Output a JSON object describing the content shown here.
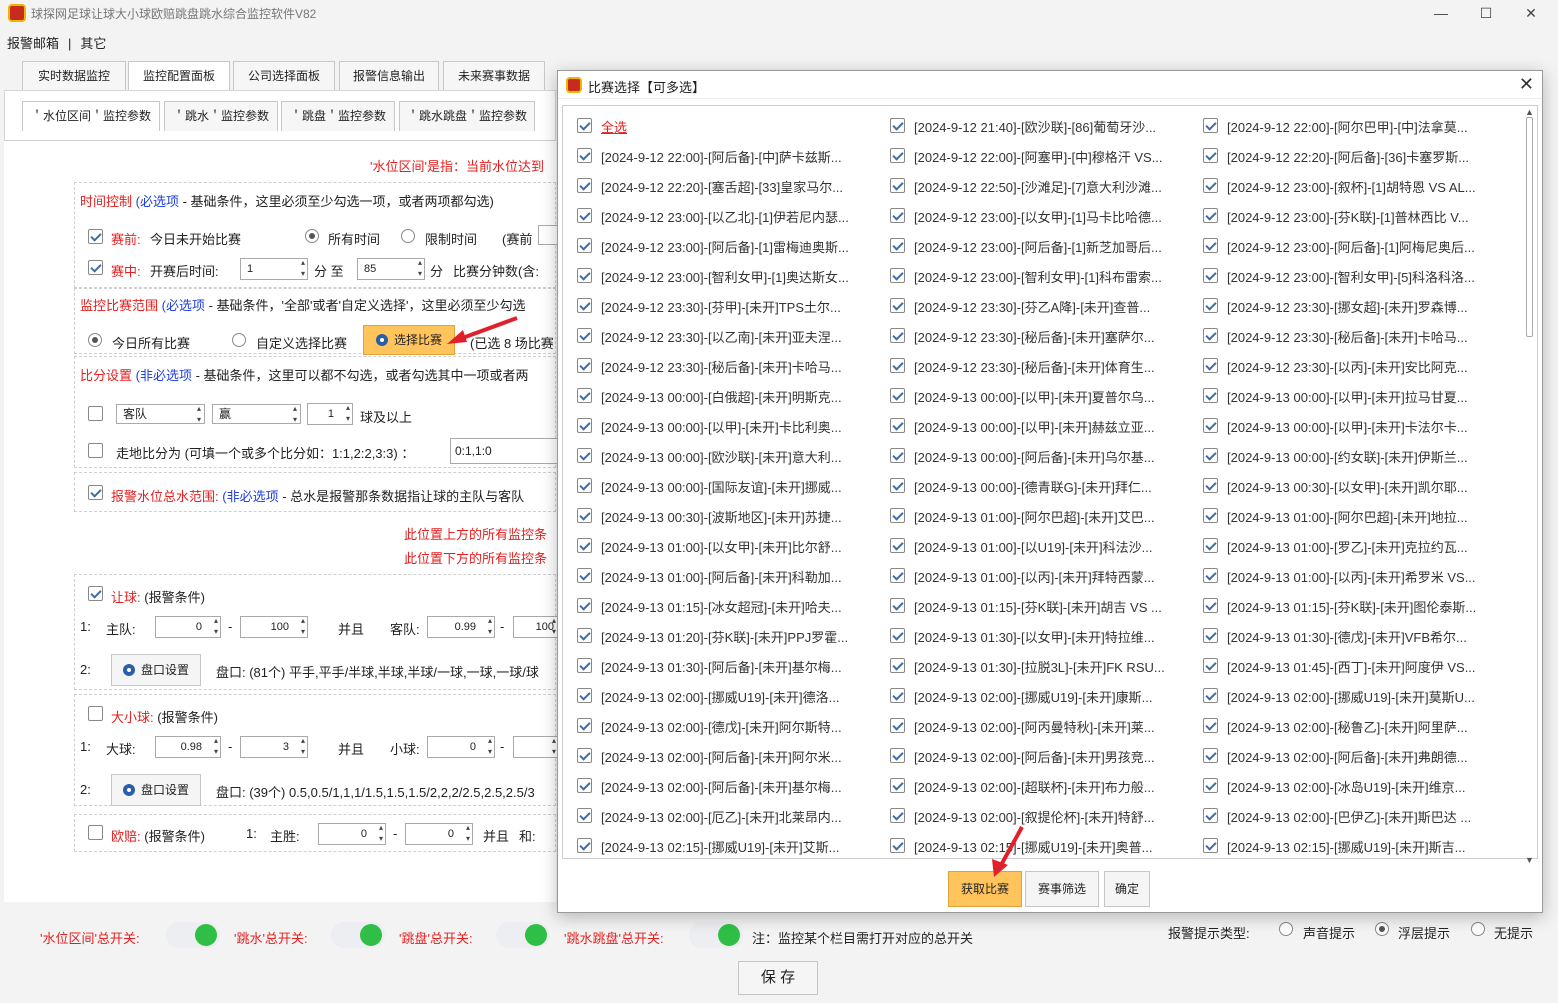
{
  "app": {
    "title": "球探网足球让球大小球欧赔跳盘跳水综合监控软件V82"
  },
  "menu": [
    "报警邮箱",
    "|",
    "其它"
  ],
  "main_tabs": [
    "实时数据监控",
    "监控配置面板",
    "公司选择面板",
    "报警信息输出",
    "未来赛事数据"
  ],
  "sub_tabs": [
    "＇水位区间＇监控参数",
    "＇跳水＇监控参数",
    "＇跳盘＇监控参数",
    "＇跳水跳盘＇监控参数"
  ],
  "config": {
    "note_top": "'水位区间'是指：当前水位达到",
    "time": {
      "title": "时间控制",
      "tag": "(必选项",
      "desc": " - 基础条件，这里必须至少勾选一项，或者两项都勾选)",
      "prematch_label": "赛前:",
      "prematch_text": "今日未开始比赛",
      "all_time": "所有时间",
      "limit_time": "限制时间",
      "before": "(赛前",
      "inplay_label": "赛中:",
      "after_start": "开赛后时间:",
      "from": "1",
      "to_word": "分 至",
      "to": "85",
      "min": "分",
      "match_minutes": "比赛分钟数(含:"
    },
    "scope": {
      "title": "监控比赛范围",
      "tag": "(必选项",
      "desc": " - 基础条件，'全部'或者'自定义选择'，这里必须至少勾选",
      "all": "今日所有比赛",
      "custom": "自定义选择比赛",
      "select_btn": "选择比赛",
      "selected": "(已选 8 场比赛"
    },
    "score": {
      "title": "比分设置",
      "tag": "(非必选项",
      "desc": " - 基础条件，这里可以都不勾选，或者勾选其中一项或者两",
      "team": "客队",
      "result": "赢",
      "num": "1",
      "suffix": "球及以上",
      "goal_label": "走地比分为 (可填一个或多个比分如：1:1,2:2,3:3) ：",
      "goal_value": "0:1,1:0"
    },
    "alarm": {
      "label": "报警水位总水范围:",
      "tag": "(非必选项",
      "desc": " - 总水是报警那条数据指让球的主队与客队"
    },
    "notice_up": "此位置上方的所有监控条",
    "notice_down": "此位置下方的所有监控条",
    "handicap": {
      "label": "让球:",
      "cond": "(报警条件)",
      "row1": "1:",
      "home": "主队:",
      "home_min": "0",
      "home_max": "100",
      "and": "并且",
      "away": "客队:",
      "away_min": "0.99",
      "away_max": "100",
      "row2": "2:",
      "pan_btn": "盘口设置",
      "pan_text": "盘口: (81个) 平手,平手/半球,半球,半球/一球,一球,一球/球"
    },
    "ou": {
      "label": "大小球:",
      "cond": "(报警条件)",
      "row1": "1:",
      "big": "大球:",
      "big_min": "0.98",
      "big_max": "3",
      "and": "并且",
      "small": "小球:",
      "small_min": "0",
      "row2": "2:",
      "pan_btn": "盘口设置",
      "pan_text": "盘口: (39个) 0.5,0.5/1,1,1/1.5,1.5,1.5/2,2,2/2.5,2.5,2.5/3"
    },
    "euro": {
      "label": "欧赔:",
      "cond": "(报警条件)",
      "row1": "1:",
      "win": "主胜:",
      "win_min": "0",
      "win_max": "0",
      "and": "并且",
      "draw": "和:"
    }
  },
  "bottom": {
    "s1": "'水位区间'总开关:",
    "s2": "'跳水'总开关:",
    "s3": "'跳盘'总开关:",
    "s4": "'跳水跳盘'总开关:",
    "note": "注：监控某个栏目需打开对应的总开关",
    "alarm_type": "报警提示类型:",
    "sound": "声音提示",
    "float": "浮层提示",
    "none": "无提示",
    "save": "保 存"
  },
  "dialog": {
    "title": "比赛选择【可多选】",
    "get_btn": "获取比赛",
    "filter_btn": "赛事筛选",
    "ok_btn": "确定",
    "items": [
      "全选",
      "[2024-9-12 21:40]-[欧沙联]-[86]葡萄牙沙...",
      "[2024-9-12 22:00]-[阿尔巴甲]-[中]法拿莫...",
      "[2024-9-12 22:00]-[阿后备]-[中]萨卡兹斯...",
      "[2024-9-12 22:00]-[阿塞甲]-[中]穆格汗 VS...",
      "[2024-9-12 22:20]-[阿后备]-[36]卡塞罗斯...",
      "[2024-9-12 22:20]-[塞舌超]-[33]皇家马尔...",
      "[2024-9-12 22:50]-[沙滩足]-[7]意大利沙滩...",
      "[2024-9-12 23:00]-[叙杯]-[1]胡特恩 VS AL...",
      "[2024-9-12 23:00]-[以乙北]-[1]伊若尼内瑟...",
      "[2024-9-12 23:00]-[以女甲]-[1]马卡比哈德...",
      "[2024-9-12 23:00]-[芬K联]-[1]普林西比 V...",
      "[2024-9-12 23:00]-[阿后备]-[1]雷梅迪奥斯...",
      "[2024-9-12 23:00]-[阿后备]-[1]新芝加哥后...",
      "[2024-9-12 23:00]-[阿后备]-[1]阿梅尼奥后...",
      "[2024-9-12 23:00]-[智利女甲]-[1]奥达斯女...",
      "[2024-9-12 23:00]-[智利女甲]-[1]科布雷索...",
      "[2024-9-12 23:00]-[智利女甲]-[5]科洛科洛...",
      "[2024-9-12 23:30]-[芬甲]-[未开]TPS土尔...",
      "[2024-9-12 23:30]-[芬乙A降]-[未开]查普...",
      "[2024-9-12 23:30]-[挪女超]-[未开]罗森博...",
      "[2024-9-12 23:30]-[以乙南]-[未开]亚夫涅...",
      "[2024-9-12 23:30]-[秘后备]-[未开]塞萨尔...",
      "[2024-9-12 23:30]-[秘后备]-[未开]卡哈马...",
      "[2024-9-12 23:30]-[秘后备]-[未开]卡哈马...",
      "[2024-9-12 23:30]-[秘后备]-[未开]体育生...",
      "[2024-9-12 23:30]-[以丙]-[未开]安比阿克...",
      "[2024-9-13 00:00]-[白俄超]-[未开]明斯克...",
      "[2024-9-13 00:00]-[以甲]-[未开]夏普尔乌...",
      "[2024-9-13 00:00]-[以甲]-[未开]拉马甘夏...",
      "[2024-9-13 00:00]-[以甲]-[未开]卡比利奥...",
      "[2024-9-13 00:00]-[以甲]-[未开]赫兹立亚...",
      "[2024-9-13 00:00]-[以甲]-[未开]卡法尔卡...",
      "[2024-9-13 00:00]-[欧沙联]-[未开]意大利...",
      "[2024-9-13 00:00]-[阿后备]-[未开]乌尔基...",
      "[2024-9-13 00:00]-[约女联]-[未开]伊斯兰...",
      "[2024-9-13 00:00]-[国际友谊]-[未开]挪威...",
      "[2024-9-13 00:00]-[德青联G]-[未开]拜仁...",
      "[2024-9-13 00:30]-[以女甲]-[未开]凯尔耶...",
      "[2024-9-13 00:30]-[波斯地区]-[未开]苏捷...",
      "[2024-9-13 01:00]-[阿尔巴超]-[未开]艾巴...",
      "[2024-9-13 01:00]-[阿尔巴超]-[未开]地拉...",
      "[2024-9-13 01:00]-[以女甲]-[未开]比尔舒...",
      "[2024-9-13 01:00]-[以U19]-[未开]科法沙...",
      "[2024-9-13 01:00]-[罗乙]-[未开]克拉约瓦...",
      "[2024-9-13 01:00]-[阿后备]-[未开]科勒加...",
      "[2024-9-13 01:00]-[以丙]-[未开]拜特西蒙...",
      "[2024-9-13 01:00]-[以丙]-[未开]希罗米 VS...",
      "[2024-9-13 01:15]-[冰女超冠]-[未开]哈夫...",
      "[2024-9-13 01:15]-[芬K联]-[未开]胡吉 VS ...",
      "[2024-9-13 01:15]-[芬K联]-[未开]图伦泰斯...",
      "[2024-9-13 01:20]-[芬K联]-[未开]PPJ罗霍...",
      "[2024-9-13 01:30]-[以女甲]-[未开]特拉维...",
      "[2024-9-13 01:30]-[德戊]-[未开]VFB希尔...",
      "[2024-9-13 01:30]-[阿后备]-[未开]基尔梅...",
      "[2024-9-13 01:30]-[拉脱3L]-[未开]FK RSU...",
      "[2024-9-13 01:45]-[西丁]-[未开]阿度伊 VS...",
      "[2024-9-13 02:00]-[挪威U19]-[未开]德洛...",
      "[2024-9-13 02:00]-[挪威U19]-[未开]康斯...",
      "[2024-9-13 02:00]-[挪威U19]-[未开]莫斯U...",
      "[2024-9-13 02:00]-[德戊]-[未开]阿尔斯特...",
      "[2024-9-13 02:00]-[阿丙曼特秋]-[未开]莱...",
      "[2024-9-13 02:00]-[秘鲁乙]-[未开]阿里萨...",
      "[2024-9-13 02:00]-[阿后备]-[未开]阿尔米...",
      "[2024-9-13 02:00]-[阿后备]-[未开]男孩竞...",
      "[2024-9-13 02:00]-[阿后备]-[未开]弗朗德...",
      "[2024-9-13 02:00]-[阿后备]-[未开]基尔梅...",
      "[2024-9-13 02:00]-[超联杯]-[未开]布力般...",
      "[2024-9-13 02:00]-[冰岛U19]-[未开]维京...",
      "[2024-9-13 02:00]-[厄乙]-[未开]北莱昂内...",
      "[2024-9-13 02:00]-[叙提伦杯]-[未开]特舒...",
      "[2024-9-13 02:00]-[巴伊乙]-[未开]斯巴达 ...",
      "[2024-9-13 02:15]-[挪威U19]-[未开]艾斯...",
      "[2024-9-13 02:15]-[挪威U19]-[未开]奥普...",
      "[2024-9-13 02:15]-[挪威U19]-[未开]斯吉..."
    ]
  }
}
